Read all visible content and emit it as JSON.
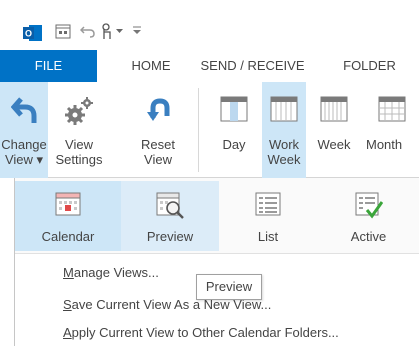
{
  "quick_access": {
    "icons": [
      "outlook-icon",
      "calendar-icon",
      "undo-icon",
      "touch-mode-icon",
      "dropdown-icon",
      "customize-icon"
    ],
    "app_badge": "O"
  },
  "ribbon_tabs": [
    {
      "label": "FILE",
      "active": true
    },
    {
      "label": "HOME"
    },
    {
      "label": "SEND / RECEIVE"
    },
    {
      "label": "FOLDER"
    }
  ],
  "ribbon": {
    "change_view": {
      "line1": "Change",
      "line2": "View ▾"
    },
    "view_settings": {
      "line1": "View",
      "line2": "Settings"
    },
    "reset_view": {
      "line1": "Reset",
      "line2": "View"
    },
    "day": {
      "line1": "Day",
      "line2": ""
    },
    "work_week": {
      "line1": "Work",
      "line2": "Week"
    },
    "week": {
      "line1": "Week",
      "line2": ""
    },
    "month": {
      "line1": "Month",
      "line2": ""
    }
  },
  "gallery": [
    {
      "label": "Calendar",
      "icon": "calendar-view-icon",
      "selected": true
    },
    {
      "label": "Preview",
      "icon": "preview-view-icon",
      "hover": true
    },
    {
      "label": "List",
      "icon": "list-view-icon"
    },
    {
      "label": "Active",
      "icon": "active-view-icon"
    }
  ],
  "menu": {
    "manage_views": {
      "first": "M",
      "rest": "anage Views..."
    },
    "save_view_as": {
      "first": "S",
      "rest": "ave Current View As a New View..."
    },
    "apply_view": {
      "first": "A",
      "rest": "pply Current View to Other Calendar Folders..."
    }
  },
  "tooltip": "Preview",
  "colors": {
    "accent": "#0072c6",
    "selected": "#cde6f7",
    "arrow": "#3a7fc0"
  }
}
